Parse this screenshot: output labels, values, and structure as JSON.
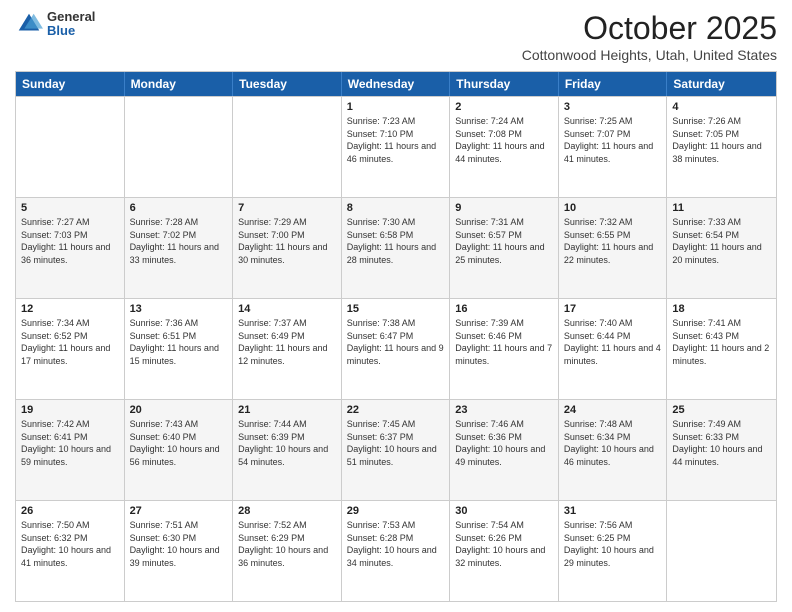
{
  "logo": {
    "general": "General",
    "blue": "Blue"
  },
  "header": {
    "month": "October 2025",
    "location": "Cottonwood Heights, Utah, United States"
  },
  "days_of_week": [
    "Sunday",
    "Monday",
    "Tuesday",
    "Wednesday",
    "Thursday",
    "Friday",
    "Saturday"
  ],
  "weeks": [
    [
      {
        "day": "",
        "info": ""
      },
      {
        "day": "",
        "info": ""
      },
      {
        "day": "",
        "info": ""
      },
      {
        "day": "1",
        "info": "Sunrise: 7:23 AM\nSunset: 7:10 PM\nDaylight: 11 hours and 46 minutes."
      },
      {
        "day": "2",
        "info": "Sunrise: 7:24 AM\nSunset: 7:08 PM\nDaylight: 11 hours and 44 minutes."
      },
      {
        "day": "3",
        "info": "Sunrise: 7:25 AM\nSunset: 7:07 PM\nDaylight: 11 hours and 41 minutes."
      },
      {
        "day": "4",
        "info": "Sunrise: 7:26 AM\nSunset: 7:05 PM\nDaylight: 11 hours and 38 minutes."
      }
    ],
    [
      {
        "day": "5",
        "info": "Sunrise: 7:27 AM\nSunset: 7:03 PM\nDaylight: 11 hours and 36 minutes."
      },
      {
        "day": "6",
        "info": "Sunrise: 7:28 AM\nSunset: 7:02 PM\nDaylight: 11 hours and 33 minutes."
      },
      {
        "day": "7",
        "info": "Sunrise: 7:29 AM\nSunset: 7:00 PM\nDaylight: 11 hours and 30 minutes."
      },
      {
        "day": "8",
        "info": "Sunrise: 7:30 AM\nSunset: 6:58 PM\nDaylight: 11 hours and 28 minutes."
      },
      {
        "day": "9",
        "info": "Sunrise: 7:31 AM\nSunset: 6:57 PM\nDaylight: 11 hours and 25 minutes."
      },
      {
        "day": "10",
        "info": "Sunrise: 7:32 AM\nSunset: 6:55 PM\nDaylight: 11 hours and 22 minutes."
      },
      {
        "day": "11",
        "info": "Sunrise: 7:33 AM\nSunset: 6:54 PM\nDaylight: 11 hours and 20 minutes."
      }
    ],
    [
      {
        "day": "12",
        "info": "Sunrise: 7:34 AM\nSunset: 6:52 PM\nDaylight: 11 hours and 17 minutes."
      },
      {
        "day": "13",
        "info": "Sunrise: 7:36 AM\nSunset: 6:51 PM\nDaylight: 11 hours and 15 minutes."
      },
      {
        "day": "14",
        "info": "Sunrise: 7:37 AM\nSunset: 6:49 PM\nDaylight: 11 hours and 12 minutes."
      },
      {
        "day": "15",
        "info": "Sunrise: 7:38 AM\nSunset: 6:47 PM\nDaylight: 11 hours and 9 minutes."
      },
      {
        "day": "16",
        "info": "Sunrise: 7:39 AM\nSunset: 6:46 PM\nDaylight: 11 hours and 7 minutes."
      },
      {
        "day": "17",
        "info": "Sunrise: 7:40 AM\nSunset: 6:44 PM\nDaylight: 11 hours and 4 minutes."
      },
      {
        "day": "18",
        "info": "Sunrise: 7:41 AM\nSunset: 6:43 PM\nDaylight: 11 hours and 2 minutes."
      }
    ],
    [
      {
        "day": "19",
        "info": "Sunrise: 7:42 AM\nSunset: 6:41 PM\nDaylight: 10 hours and 59 minutes."
      },
      {
        "day": "20",
        "info": "Sunrise: 7:43 AM\nSunset: 6:40 PM\nDaylight: 10 hours and 56 minutes."
      },
      {
        "day": "21",
        "info": "Sunrise: 7:44 AM\nSunset: 6:39 PM\nDaylight: 10 hours and 54 minutes."
      },
      {
        "day": "22",
        "info": "Sunrise: 7:45 AM\nSunset: 6:37 PM\nDaylight: 10 hours and 51 minutes."
      },
      {
        "day": "23",
        "info": "Sunrise: 7:46 AM\nSunset: 6:36 PM\nDaylight: 10 hours and 49 minutes."
      },
      {
        "day": "24",
        "info": "Sunrise: 7:48 AM\nSunset: 6:34 PM\nDaylight: 10 hours and 46 minutes."
      },
      {
        "day": "25",
        "info": "Sunrise: 7:49 AM\nSunset: 6:33 PM\nDaylight: 10 hours and 44 minutes."
      }
    ],
    [
      {
        "day": "26",
        "info": "Sunrise: 7:50 AM\nSunset: 6:32 PM\nDaylight: 10 hours and 41 minutes."
      },
      {
        "day": "27",
        "info": "Sunrise: 7:51 AM\nSunset: 6:30 PM\nDaylight: 10 hours and 39 minutes."
      },
      {
        "day": "28",
        "info": "Sunrise: 7:52 AM\nSunset: 6:29 PM\nDaylight: 10 hours and 36 minutes."
      },
      {
        "day": "29",
        "info": "Sunrise: 7:53 AM\nSunset: 6:28 PM\nDaylight: 10 hours and 34 minutes."
      },
      {
        "day": "30",
        "info": "Sunrise: 7:54 AM\nSunset: 6:26 PM\nDaylight: 10 hours and 32 minutes."
      },
      {
        "day": "31",
        "info": "Sunrise: 7:56 AM\nSunset: 6:25 PM\nDaylight: 10 hours and 29 minutes."
      },
      {
        "day": "",
        "info": ""
      }
    ]
  ]
}
